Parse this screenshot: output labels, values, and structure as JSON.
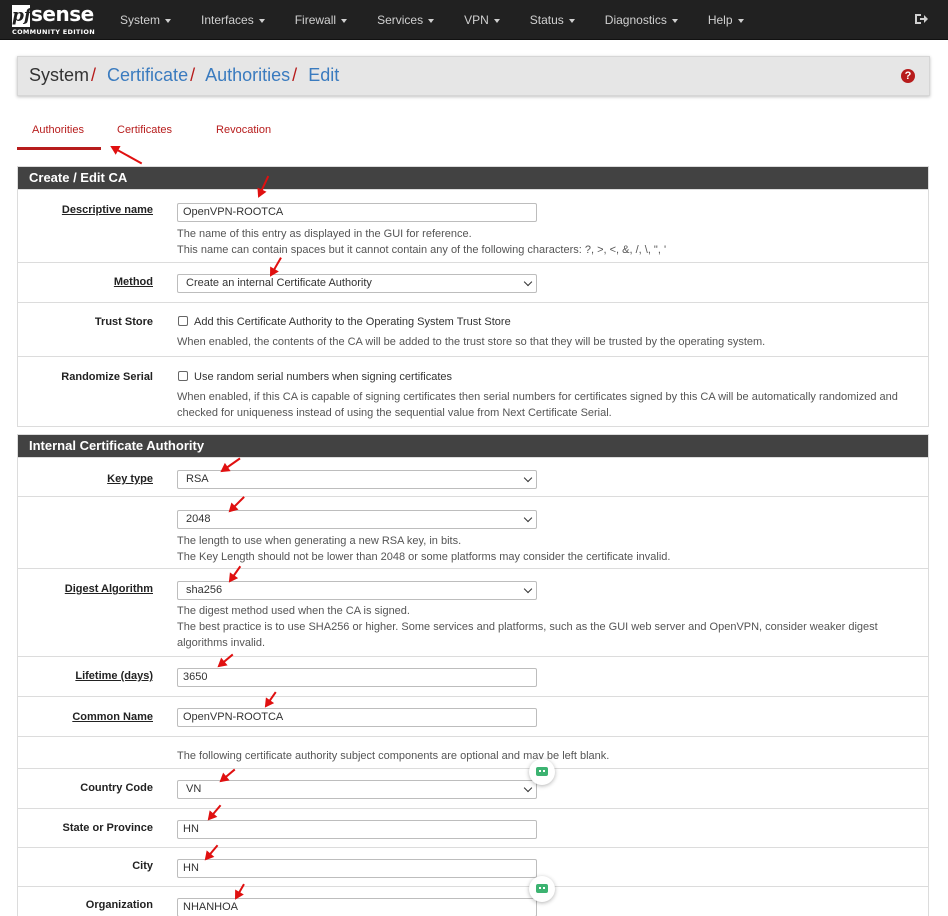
{
  "logo": {
    "mark": "pf",
    "name": "sense",
    "edition": "COMMUNITY EDITION"
  },
  "nav": [
    "System",
    "Interfaces",
    "Firewall",
    "Services",
    "VPN",
    "Status",
    "Diagnostics",
    "Help"
  ],
  "breadcrumb": {
    "root": "System",
    "items": [
      "Certificate",
      "Authorities",
      "Edit"
    ],
    "sep": "/"
  },
  "tabs": [
    "Authorities",
    "Certificates",
    "Revocation"
  ],
  "panel_create": {
    "title": "Create / Edit CA",
    "descriptive_name": {
      "label": "Descriptive name",
      "value": "OpenVPN-ROOTCA",
      "help1": "The name of this entry as displayed in the GUI for reference.",
      "help2": "This name can contain spaces but it cannot contain any of the following characters: ?, >, <, &, /, \\, \", '"
    },
    "method": {
      "label": "Method",
      "value": "Create an internal Certificate Authority"
    },
    "trust_store": {
      "label": "Trust Store",
      "checkbox": "Add this Certificate Authority to the Operating System Trust Store",
      "help": "When enabled, the contents of the CA will be added to the trust store so that they will be trusted by the operating system."
    },
    "randomize_serial": {
      "label": "Randomize Serial",
      "checkbox": "Use random serial numbers when signing certificates",
      "help1": "When enabled, if this CA is capable of signing certificates then serial numbers for certificates signed by this CA will be automatically randomized and",
      "help2": "checked for uniqueness instead of using the sequential value from Next Certificate Serial."
    }
  },
  "panel_internal": {
    "title": "Internal Certificate Authority",
    "key_type": {
      "label": "Key type",
      "value": "RSA"
    },
    "key_length": {
      "value": "2048",
      "help1": "The length to use when generating a new RSA key, in bits.",
      "help2": "The Key Length should not be lower than 2048 or some platforms may consider the certificate invalid."
    },
    "digest": {
      "label": "Digest Algorithm",
      "value": "sha256",
      "help1": "The digest method used when the CA is signed.",
      "help2": "The best practice is to use SHA256 or higher. Some services and platforms, such as the GUI web server and OpenVPN, consider weaker digest",
      "help3": "algorithms invalid."
    },
    "lifetime": {
      "label": "Lifetime (days)",
      "value": "3650"
    },
    "common_name": {
      "label": "Common Name",
      "value": "OpenVPN-ROOTCA"
    },
    "subject_note": "The following certificate authority subject components are optional and may be left blank.",
    "country": {
      "label": "Country Code",
      "value": "VN"
    },
    "state": {
      "label": "State or Province",
      "value": "HN"
    },
    "city": {
      "label": "City",
      "value": "HN"
    },
    "organization": {
      "label": "Organization",
      "value": "NHANHOA"
    }
  }
}
